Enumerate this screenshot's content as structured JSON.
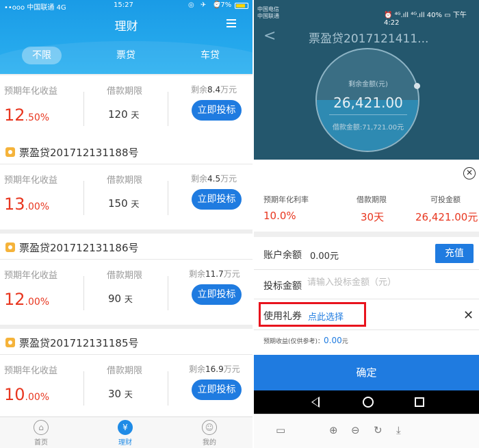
{
  "left": {
    "status": {
      "carrier": "••ooo 中国联通 4G",
      "time": "15:27",
      "icons": "◎ ✈ ⌚",
      "battery": "77%"
    },
    "title": "理财",
    "tabs": [
      "不限",
      "票贷",
      "车贷"
    ],
    "labels": {
      "rate": "预期年化收益",
      "term": "借款期限",
      "remain_prefix": "剩余",
      "remain_unit": "万元",
      "days_unit": "天",
      "invest": "立即投标"
    },
    "products": [
      {
        "name": "",
        "rate_int": "12",
        "rate_dec": ".50%",
        "days": "120",
        "remain": "8.4"
      },
      {
        "name": "票盈贷201712131188号",
        "rate_int": "13",
        "rate_dec": ".00%",
        "days": "150",
        "remain": "4.5"
      },
      {
        "name": "票盈贷201712131186号",
        "rate_int": "12",
        "rate_dec": ".00%",
        "days": "90",
        "remain": "11.7"
      },
      {
        "name": "票盈贷201712131185号",
        "rate_int": "10",
        "rate_dec": ".00%",
        "days": "30",
        "remain": "16.9"
      }
    ],
    "tabbar": [
      {
        "label": "首页",
        "icon": "home-icon"
      },
      {
        "label": "理财",
        "icon": "yen-icon"
      },
      {
        "label": "我的",
        "icon": "user-icon"
      }
    ]
  },
  "right": {
    "status": {
      "carrier1": "中国电信",
      "carrier2": "中国联通",
      "right": "⏰ ⁴ᴳ.ıll ⁴ᴳ.ıll 40% ▭ 下午4:22"
    },
    "title": "票盈贷2017121411...",
    "circle": {
      "remain_label": "剩余金额(元)",
      "remain_amount": "26,421.00",
      "loan_amount": "借款金额:71,721.00元"
    },
    "stats": [
      {
        "label": "预期年化利率",
        "value": "10.0%"
      },
      {
        "label": "借款期限",
        "value": "30天"
      },
      {
        "label": "可投金额",
        "value": "26,421.00元"
      }
    ],
    "balance_label": "账户余额",
    "balance_value": "0.00元",
    "recharge": "充值",
    "amount_label": "投标金额",
    "amount_placeholder": "请输入投标金额（元）",
    "coupon_label": "使用礼券",
    "coupon_link": "点此选择",
    "expect_label": "预期收益(仅供参考)：",
    "expect_value": "0.00",
    "expect_unit": "元",
    "confirm": "确定",
    "accent": "#1f7be0",
    "highlight": "#e8131d"
  }
}
